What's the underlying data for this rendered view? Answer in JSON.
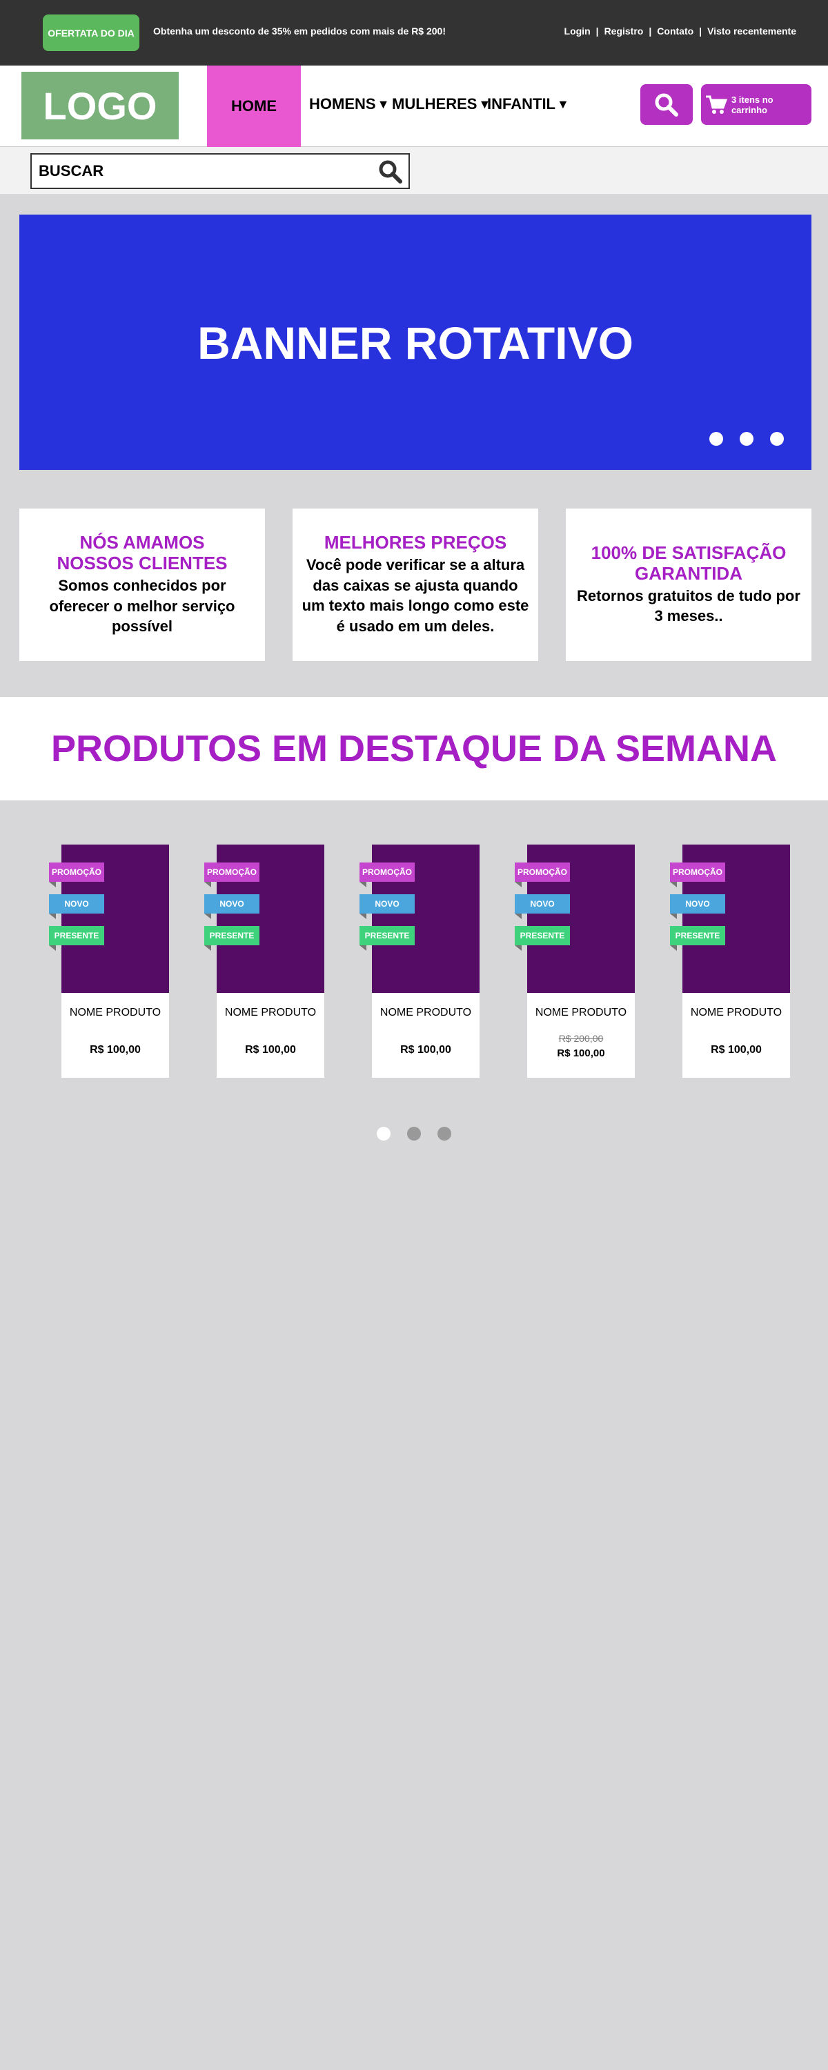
{
  "topbar": {
    "deal_badge": "OFERTATA DO DIA",
    "promo": "Obtenha um desconto de 35% em pedidos com mais de R$ 200!",
    "links": [
      "Login",
      "Registro",
      "Contato",
      "Visto recentemente"
    ],
    "separator": "|"
  },
  "header": {
    "logo": "LOGO",
    "nav": [
      {
        "label": "HOME",
        "active": true
      },
      {
        "label": "HOMENS",
        "caret": "▼"
      },
      {
        "label": "MULHERES",
        "caret": "▼"
      },
      {
        "label": "INFANTIL",
        "caret": "▼"
      }
    ],
    "cart_label": "3 itens no carrinho",
    "icons": {
      "search": "search-icon",
      "cart": "cart-icon"
    }
  },
  "search": {
    "placeholder": "BUSCAR"
  },
  "banner": {
    "title": "BANNER ROTATIVO",
    "dots": 3
  },
  "features": [
    {
      "title": "NÓS AMAMOS NOSSOS CLIENTES",
      "text": "Somos conhecidos por oferecer o melhor serviço possível"
    },
    {
      "title": "MELHORES PREÇOS",
      "text": "Você pode verificar se a altura das caixas se ajusta quando um texto mais  longo como este é usado em um deles."
    },
    {
      "title": "100% DE SATISFAÇÃO GARANTIDA",
      "text": "Retornos gratuitos de tudo por 3 meses.."
    }
  ],
  "featured": {
    "title": "PRODUTOS EM DESTAQUE DA SEMANA"
  },
  "tags": {
    "promo": "PROMOÇÃO",
    "novo": "NOVO",
    "presente": "PRESENTE"
  },
  "products": [
    {
      "name": "NOME PRODUTO",
      "price": "R$ 100,00"
    },
    {
      "name": "NOME PRODUTO",
      "price": "R$ 100,00"
    },
    {
      "name": "NOME PRODUTO",
      "price": "R$ 100,00"
    },
    {
      "name": "NOME PRODUTO",
      "old_price": "R$ 200,00",
      "price": "R$ 100,00"
    },
    {
      "name": "NOME PRODUTO",
      "price": "R$ 100,00"
    }
  ],
  "colors": {
    "topbar": "#333333",
    "accent": "#b330c0",
    "home": "#e957d1",
    "banner": "#2832dc",
    "heading": "#a51fc4",
    "product": "#540c64",
    "deal": "#5cb85c",
    "background": "#d7d6d8"
  }
}
